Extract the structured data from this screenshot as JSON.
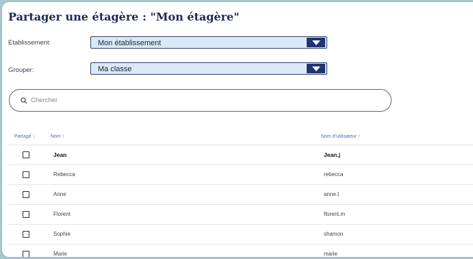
{
  "page": {
    "title": "Partager une étagère : \"Mon étagère\""
  },
  "form": {
    "etablissement": {
      "label": "Etablissement:",
      "value": "Mon établissement"
    },
    "grouper": {
      "label": "Grouper:",
      "value": "Ma classe"
    }
  },
  "search": {
    "placeholder": "Chercher"
  },
  "table": {
    "headers": {
      "partage": "Partagé ↓",
      "nom": "Nom ↑",
      "utilisateur": "Nom d'utilisateur ↑"
    },
    "rows": [
      {
        "nom": "Jean",
        "utilisateur": "Jean.j"
      },
      {
        "nom": "Rebecca",
        "utilisateur": "rebecca"
      },
      {
        "nom": "Anne",
        "utilisateur": "anne.t"
      },
      {
        "nom": "Florent",
        "utilisateur": "florent.m"
      },
      {
        "nom": "Sophie",
        "utilisateur": "shamon"
      },
      {
        "nom": "Marie",
        "utilisateur": "marie"
      }
    ]
  },
  "colors": {
    "accent": "#1f3470",
    "select_bg": "#dbe9f6",
    "header_link": "#3f6bd8",
    "backdrop": "#a9c7cf"
  }
}
